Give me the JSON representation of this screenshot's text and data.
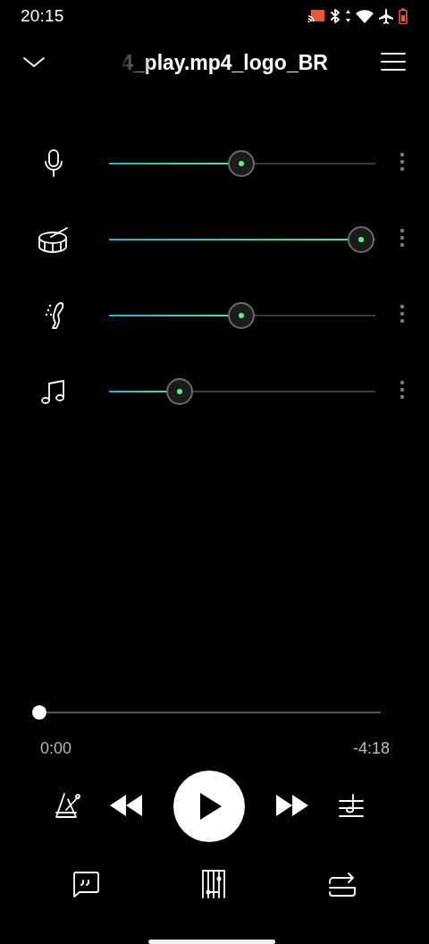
{
  "status_bar": {
    "time": "20:15"
  },
  "header": {
    "title": "4_play.mp4_logo_BR"
  },
  "tracks": [
    {
      "kind": "vocals",
      "level": 0.5
    },
    {
      "kind": "drums",
      "level": 0.95
    },
    {
      "kind": "guitar",
      "level": 0.5
    },
    {
      "kind": "other",
      "level": 0.27
    }
  ],
  "player": {
    "level": 0,
    "elapsed": "0:00",
    "remaining": "-4:18",
    "playing": false
  }
}
